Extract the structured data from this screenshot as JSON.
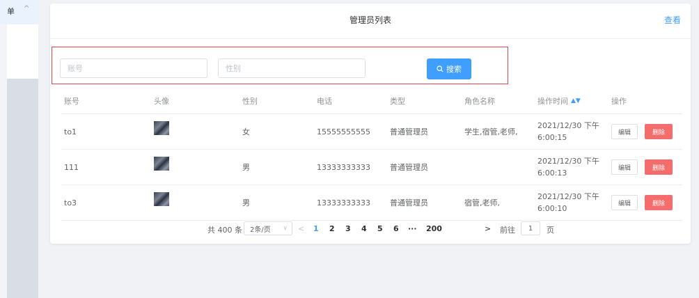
{
  "sidebar": {
    "menu_label": "单",
    "menu_arrow": "^"
  },
  "card": {
    "title": "管理员列表",
    "view_link": "查看"
  },
  "search": {
    "account_placeholder": "账号",
    "gender_placeholder": "性别",
    "button_label": "搜索",
    "button_icon": "search-icon"
  },
  "table": {
    "columns": {
      "account": "账号",
      "avatar": "头像",
      "gender": "性别",
      "phone": "电话",
      "type": "类型",
      "role": "角色名称",
      "time": "操作时间",
      "ops": "操作"
    },
    "sort_icon": "sort-icon",
    "rows": [
      {
        "account": "to1",
        "gender": "女",
        "phone": "15555555555",
        "type": "普通管理员",
        "role": "学生,宿管,老师,",
        "time": "2021/12/30 下午6:00:15"
      },
      {
        "account": "111",
        "gender": "男",
        "phone": "13333333333",
        "type": "普通管理员",
        "role": "",
        "time": "2021/12/30 下午6:00:13"
      },
      {
        "account": "to3",
        "gender": "男",
        "phone": "13333333333",
        "type": "普通管理员",
        "role": "宿管,老师,",
        "time": "2021/12/30 下午6:00:10"
      }
    ],
    "edit_label": "编辑",
    "delete_label": "删除"
  },
  "pagination": {
    "total": "共 400 条",
    "page_size": "2条/页",
    "prev": "<",
    "pages": [
      "1",
      "2",
      "3",
      "4",
      "5",
      "6",
      "···",
      "200"
    ],
    "current_page": "1",
    "next": ">",
    "goto_label": "前往",
    "goto_value": "1",
    "page_suffix": "页"
  },
  "colors": {
    "primary": "#409eff",
    "danger": "#f56c6c",
    "highlight_border": "#e0464f"
  }
}
